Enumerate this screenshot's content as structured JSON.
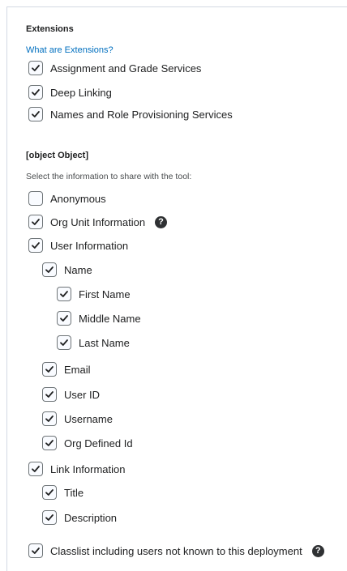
{
  "extensions": {
    "title": "Extensions",
    "link": "What are Extensions?",
    "items": [
      {
        "label": "Assignment and Grade Services",
        "checked": true
      },
      {
        "label": "Deep Linking",
        "checked": true
      },
      {
        "label": "Names and Role Provisioning Services",
        "checked": true
      }
    ]
  },
  "security": {
    "title": {
      "label": "Title",
      "checked": true
    },
    "helper": "Select the information to share with the tool:",
    "anonymous": {
      "label": "Anonymous",
      "checked": false
    },
    "org_unit": {
      "label": "Org Unit Information",
      "checked": true,
      "help_icon": "?"
    },
    "user_info": {
      "label": "User Information",
      "checked": true
    },
    "name": {
      "label": "Name",
      "checked": true
    },
    "first_name": {
      "label": "First Name",
      "checked": true
    },
    "middle_name": {
      "label": "Middle Name",
      "checked": true
    },
    "last_name": {
      "label": "Last Name",
      "checked": true
    },
    "email": {
      "label": "Email",
      "checked": true
    },
    "user_id": {
      "label": "User ID",
      "checked": true
    },
    "username": {
      "label": "Username",
      "checked": true
    },
    "org_defined_id": {
      "label": "Org Defined Id",
      "checked": true
    },
    "link_info": {
      "label": "Link Information",
      "checked": true
    },
    "description": {
      "label": "Description",
      "checked": true
    },
    "classlist": {
      "label": "Classlist including users not known to this deployment",
      "checked": true,
      "help_icon": "?"
    }
  },
  "icons": {
    "checkbox": "check-icon",
    "help": "help-circle-icon"
  },
  "colors": {
    "link": "#006fbf",
    "checkbox_border": "#6e7477",
    "text": "#202122"
  }
}
